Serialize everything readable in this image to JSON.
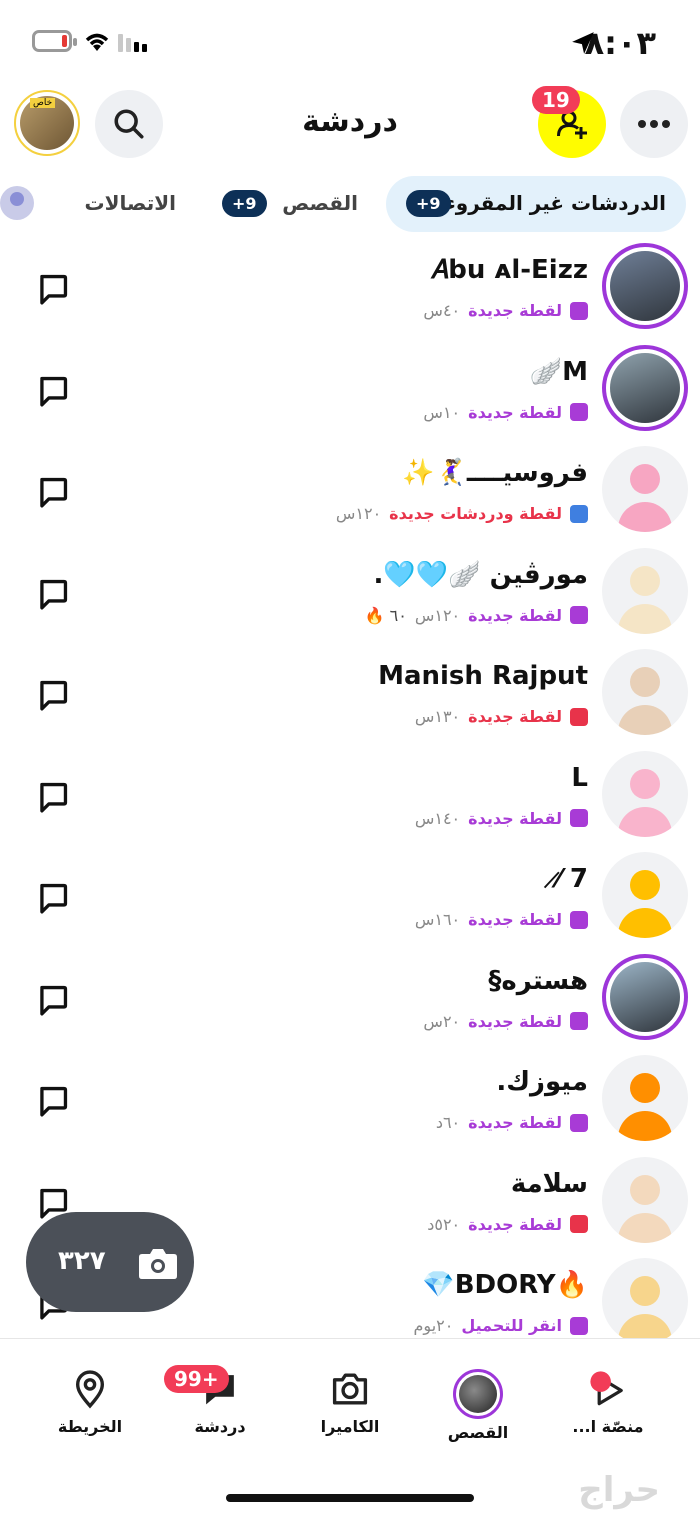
{
  "status_bar": {
    "time": "٨:٠٣"
  },
  "header": {
    "title": "دردشة",
    "friend_requests_badge": "19",
    "avatar_caption": "خاص"
  },
  "tabs": [
    {
      "label": "الدردشات غير المقروءة",
      "count": "+9"
    },
    {
      "label": "القصص",
      "count": "+9"
    },
    {
      "label": "الاتصالات"
    }
  ],
  "chats": [
    {
      "name": "𝐴bu ᴀl-Eizz",
      "status": "لقطة جديدة",
      "time": "٤٠س",
      "status_color": "#a83bd6",
      "square_color": "#a83bd6",
      "extra": "",
      "ring": true,
      "avatar_color": "#6f7f97"
    },
    {
      "name": "M🪽",
      "status": "لقطة جديدة",
      "time": "١٠س",
      "status_color": "#a83bd6",
      "square_color": "#a83bd6",
      "extra": "",
      "ring": true,
      "avatar_color": "#8fa2ad"
    },
    {
      "name": "فروسيــــ🤾‍♀️✨",
      "status": "لقطة ودردشات جديدة",
      "time": "١٢٠س",
      "status_color": "#e8334a",
      "square_color": "#3f7fe0",
      "extra": "",
      "ring": false,
      "avatar_color": "#f7a6c2"
    },
    {
      "name": "مورڤين 🪽🩵🩵.",
      "status": "لقطة جديدة",
      "time": "١٢٠س",
      "status_color": "#a83bd6",
      "square_color": "#a83bd6",
      "extra": "٦٠ 🔥",
      "ring": false,
      "avatar_color": "#f5e5c6"
    },
    {
      "name": "Manish Rajput",
      "status": "لقطة جديدة",
      "time": "١٣٠س",
      "status_color": "#e8334a",
      "square_color": "#e8334a",
      "extra": "",
      "ring": false,
      "avatar_color": "#e8d0b8"
    },
    {
      "name": "L",
      "status": "لقطة جديدة",
      "time": "١٤٠س",
      "status_color": "#a83bd6",
      "square_color": "#a83bd6",
      "extra": "",
      "ring": false,
      "avatar_color": "#f9b4cc"
    },
    {
      "name": "7 ⁄̷",
      "status": "لقطة جديدة",
      "time": "١٦٠س",
      "status_color": "#a83bd6",
      "square_color": "#a83bd6",
      "extra": "",
      "ring": false,
      "avatar_color": "#ffbf00"
    },
    {
      "name": "هستره§",
      "status": "لقطة جديدة",
      "time": "٢٠س",
      "status_color": "#a83bd6",
      "square_color": "#a83bd6",
      "extra": "",
      "ring": true,
      "avatar_color": "#9cb5c7"
    },
    {
      "name": "ميوزك.",
      "status": "لقطة جديدة",
      "time": "٦٠د",
      "status_color": "#a83bd6",
      "square_color": "#a83bd6",
      "extra": "",
      "ring": false,
      "avatar_color": "#ff8f00"
    },
    {
      "name": "سلامة",
      "status": "لقطة جديدة",
      "time": "٥٢٠د",
      "status_color": "#a83bd6",
      "square_color": "#e8334a",
      "extra": "",
      "ring": false,
      "avatar_color": "#f3d9bd"
    },
    {
      "name": "🔥BDORY💎",
      "status": "انقر للتحميل",
      "time": "٢٠يوم",
      "status_color": "#a83bd6",
      "square_color": "#a83bd6",
      "extra": "",
      "ring": false,
      "avatar_color": "#f7d58c"
    }
  ],
  "camera_fab": {
    "count": "٣٢٧"
  },
  "bottom_nav": {
    "map": "الخريطة",
    "chat": "دردشة",
    "chat_badge": "99+",
    "camera": "الكاميرا",
    "stories": "القصص",
    "spotlight": "منصّة ا..."
  },
  "watermark": "حراج",
  "icons": [
    "location-arrow-icon",
    "wifi-icon",
    "signal-icon",
    "battery-icon",
    "more-icon",
    "add-friend-icon",
    "search-icon",
    "chat-bubble-icon",
    "camera-icon",
    "map-pin-icon",
    "play-icon"
  ]
}
